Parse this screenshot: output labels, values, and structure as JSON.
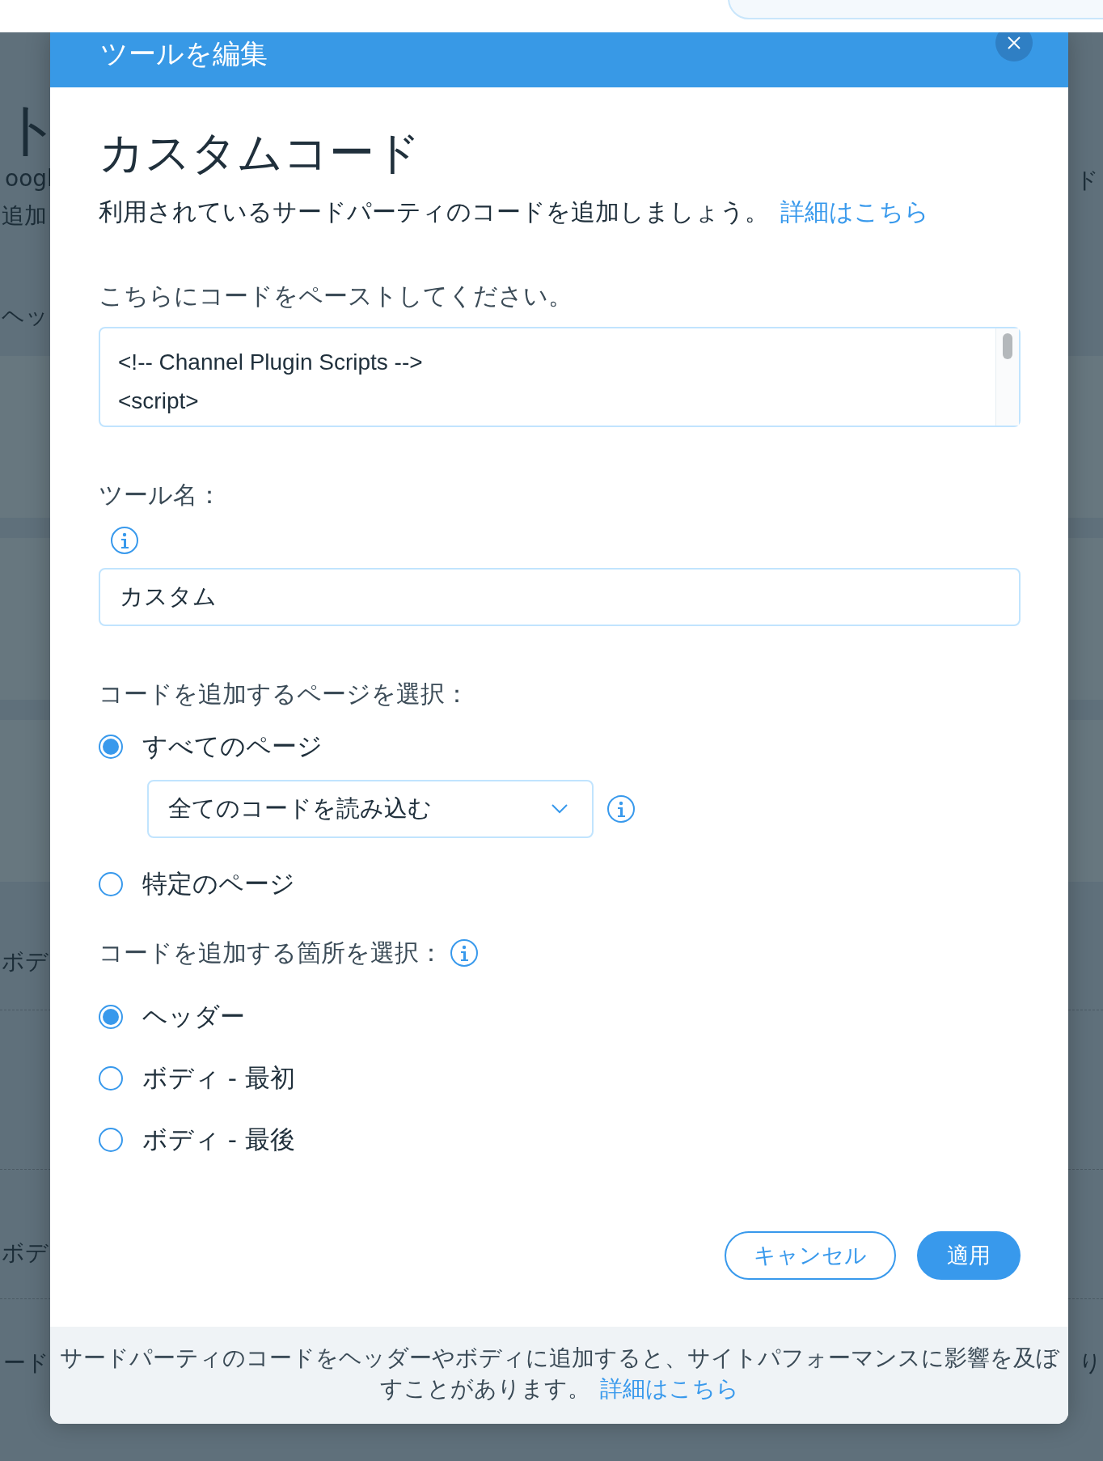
{
  "background": {
    "fragments": [
      "ト",
      "oogl",
      "追加",
      "ヘッ",
      "ボデ",
      "ボデ",
      "ード",
      "ド",
      "り"
    ]
  },
  "dialog": {
    "window_title": "ツールを編集",
    "title": "カスタムコード",
    "subtitle": "利用されているサードパーティのコードを追加しましょう。",
    "subtitle_link": "詳細はこちら",
    "code_label": "こちらにコードをペーストしてください。",
    "code_lines": [
      "<!-- Channel Plugin Scripts -->",
      "<script>"
    ],
    "name_label": "ツール名：",
    "name_value": "カスタム",
    "pages_label": "コードを追加するページを選択：",
    "page_options": [
      {
        "label": "すべてのページ",
        "selected": true,
        "dropdown": "全てのコードを読み込む"
      },
      {
        "label": "特定のページ",
        "selected": false
      }
    ],
    "placement_label": "コードを追加する箇所を選択：",
    "placement_options": [
      {
        "label": "ヘッダー",
        "selected": true
      },
      {
        "label": "ボディ - 最初",
        "selected": false
      },
      {
        "label": "ボディ - 最後",
        "selected": false
      }
    ],
    "buttons": [
      {
        "label": "キャンセル",
        "kind": "secondary"
      },
      {
        "label": "適用",
        "kind": "primary"
      }
    ],
    "footer_text": "サードパーティのコードをヘッダーやボディに追加すると、サイトパフォーマンスに影響を及ぼすことがあります。",
    "footer_link": "詳細はこちら"
  }
}
